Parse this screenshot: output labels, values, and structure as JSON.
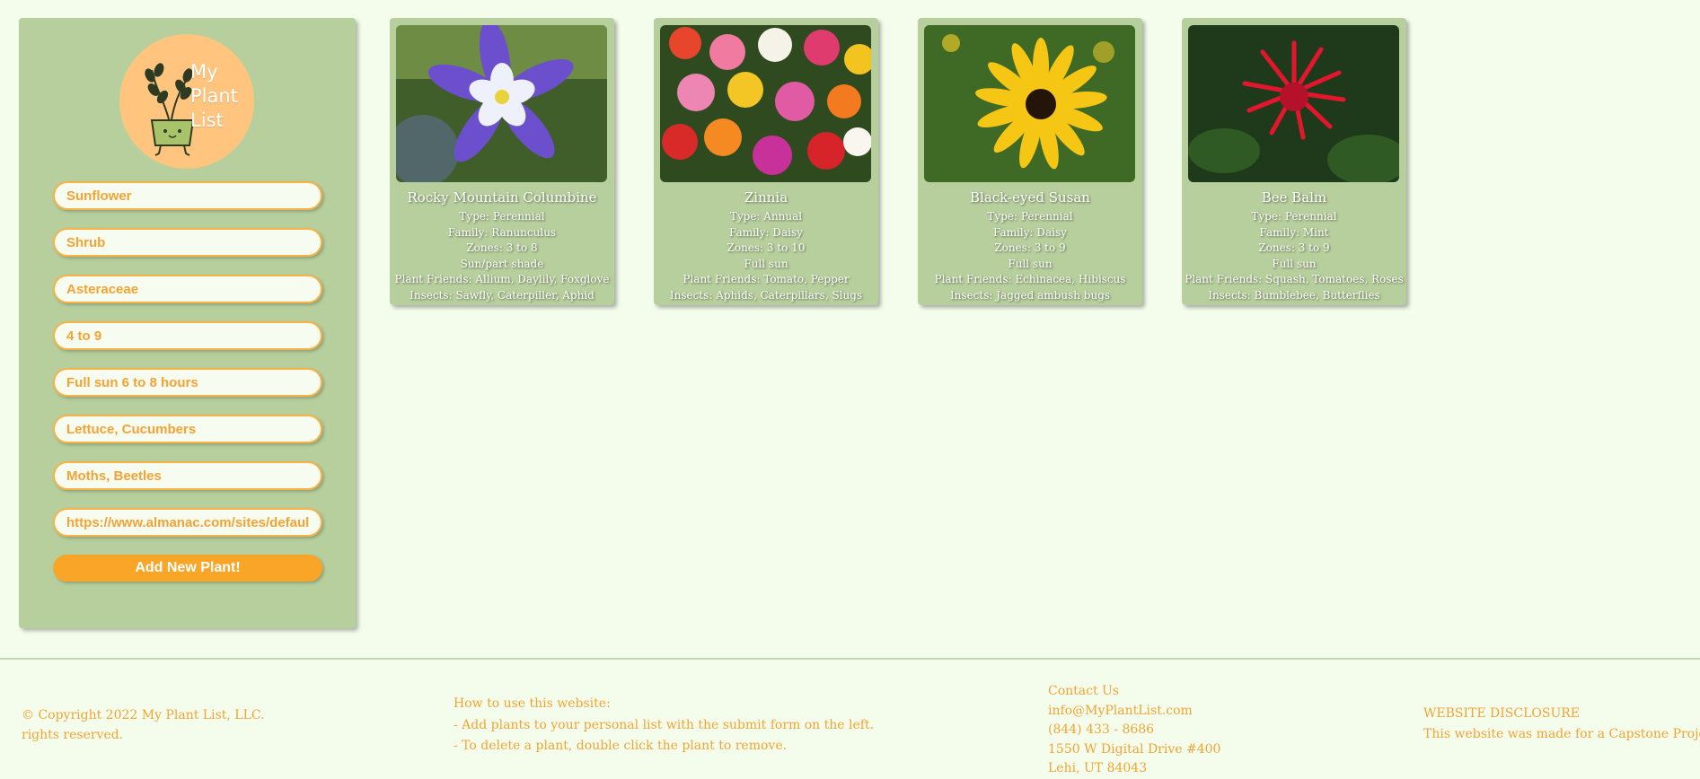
{
  "logo": {
    "line1": "My",
    "line2": "Plant",
    "line3": "List"
  },
  "form": {
    "fields": [
      {
        "placeholder": "Sunflower"
      },
      {
        "placeholder": "Shrub"
      },
      {
        "placeholder": "Asteraceae"
      },
      {
        "placeholder": "4 to 9"
      },
      {
        "placeholder": "Full sun 6 to 8 hours"
      },
      {
        "placeholder": "Lettuce, Cucumbers"
      },
      {
        "placeholder": "Moths, Beetles"
      },
      {
        "placeholder": "https://www.almanac.com/sites/default"
      }
    ],
    "submit_label": "Add New Plant!"
  },
  "plants": [
    {
      "name": "Rocky Mountain Columbine",
      "type": "Type: Perennial",
      "family": "Family: Ranunculus",
      "zones": "Zones: 3 to 8",
      "sun": "Sun/part shade",
      "friends": "Plant Friends: Allium, Daylily, Foxglove",
      "insects": "Insects: Sawfly, Caterpiller, Aphid"
    },
    {
      "name": "Zinnia",
      "type": "Type: Annual",
      "family": "Family: Daisy",
      "zones": "Zones: 3 to 10",
      "sun": "Full sun",
      "friends": "Plant Friends: Tomato, Pepper",
      "insects": "Insects: Aphids, Caterpillars, Slugs"
    },
    {
      "name": "Black-eyed Susan",
      "type": "Type: Perennial",
      "family": "Family: Daisy",
      "zones": "Zones: 3 to 9",
      "sun": "Full sun",
      "friends": "Plant Friends: Echinacea, Hibiscus",
      "insects": "Insects: Jagged ambush bugs"
    },
    {
      "name": "Bee Balm",
      "type": "Type: Perennial",
      "family": "Family: Mint",
      "zones": "Zones: 3 to 9",
      "sun": "Full sun",
      "friends": "Plant Friends: Squash, Tomatoes, Roses",
      "insects": "Insects: Bumblebee, Butterflies"
    }
  ],
  "footer": {
    "copyright": "© Copyright 2022 My Plant List, LLC.",
    "rights": "rights reserved.",
    "howto_title": "How to use this website:",
    "howto_1": "- Add plants to your personal list with the submit form on the left.",
    "howto_2": "- To delete a plant, double click the plant to remove.",
    "contact_title": "Contact Us",
    "email": "info@MyPlantList.com",
    "phone": "(844) 433 - 8686",
    "address1": "1550 W Digital Drive #400",
    "address2": "Lehi, UT 84043",
    "disclosure_title": "WEBSITE DISCLOSURE",
    "disclosure_text": "This website was made for a Capstone Project"
  },
  "colors": {
    "background": "#f4fdec",
    "panel": "#b7cf9c",
    "accent": "#f9a628",
    "logo_circle": "#ffc57f"
  }
}
